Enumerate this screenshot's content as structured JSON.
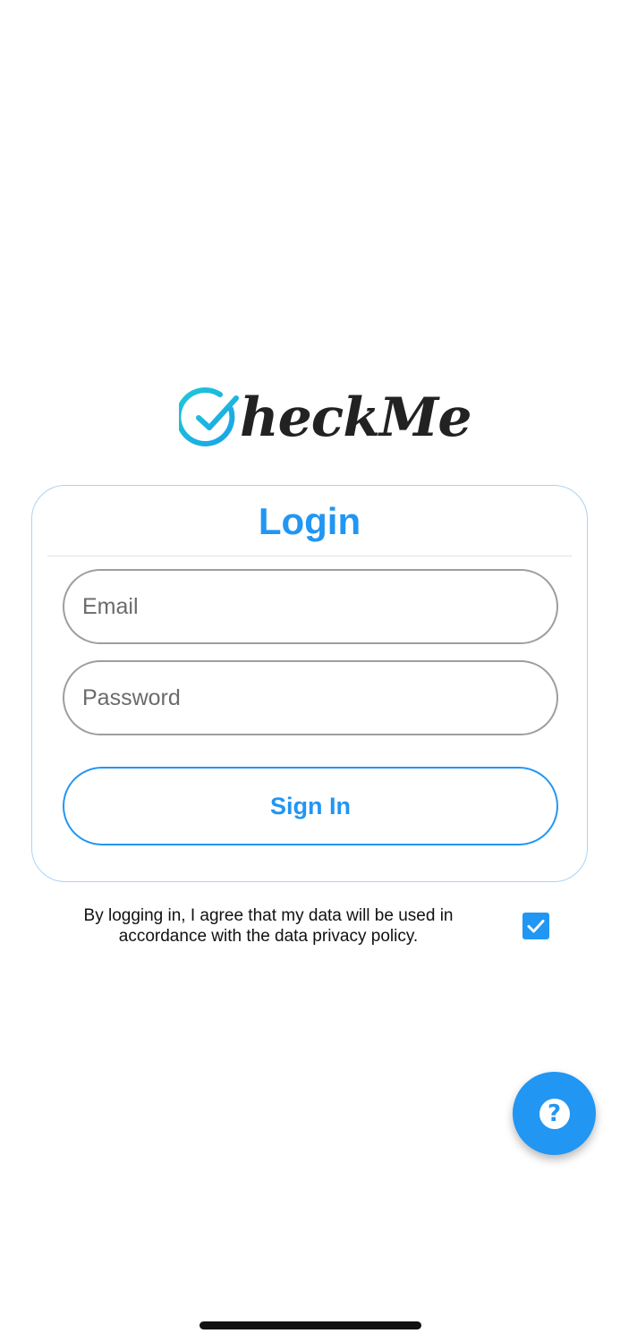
{
  "app": {
    "logo_text": "heckMe"
  },
  "login": {
    "title": "Login",
    "email_placeholder": "Email",
    "email_value": "",
    "password_placeholder": "Password",
    "password_value": "",
    "signin_label": "Sign In"
  },
  "consent": {
    "text": "By logging in, I agree that my data will be used in accordance with the data privacy policy.",
    "checked": true
  },
  "fab": {
    "icon": "help-icon",
    "glyph": "?"
  },
  "colors": {
    "accent": "#2196f3",
    "logo_gradient_start": "#1ec8d8",
    "logo_gradient_end": "#1aa3e8"
  }
}
